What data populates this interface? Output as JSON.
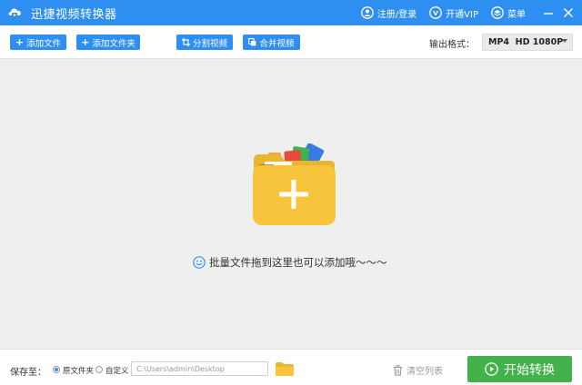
{
  "titlebar": {
    "app_title": "迅捷视频转换器",
    "register_login": "注册/登录",
    "open_vip": "开通VIP",
    "menu": "菜单"
  },
  "toolbar": {
    "add_file": "添加文件",
    "add_folder": "添加文件夹",
    "split_video": "分割视频",
    "merge_video": "合并视频",
    "output_format_label": "输出格式：",
    "output_format_value": "MP4  HD 1080P"
  },
  "dropzone": {
    "hint": "批量文件拖到这里也可以添加哦～～～"
  },
  "bottombar": {
    "save_to_label": "保存至：",
    "option_source_folder": "原文件夹",
    "option_custom": "自定义",
    "selected_option": "原文件夹",
    "path_value": "C:\\Users\\admin\\Desktop",
    "clear_list": "清空列表",
    "start_convert": "开始转换"
  },
  "colors": {
    "brand_blue": "#2e8ff0",
    "start_green": "#44b24b",
    "folder_yellow": "#f7c43b"
  },
  "icons": [
    "app-logo-icon",
    "user-icon",
    "vip-icon",
    "menu-icon",
    "minimize-icon",
    "close-icon",
    "plus-icon",
    "split-icon",
    "merge-icon",
    "folder-add-icon",
    "smile-icon",
    "folder-icon",
    "trash-icon",
    "play-circle-icon"
  ]
}
